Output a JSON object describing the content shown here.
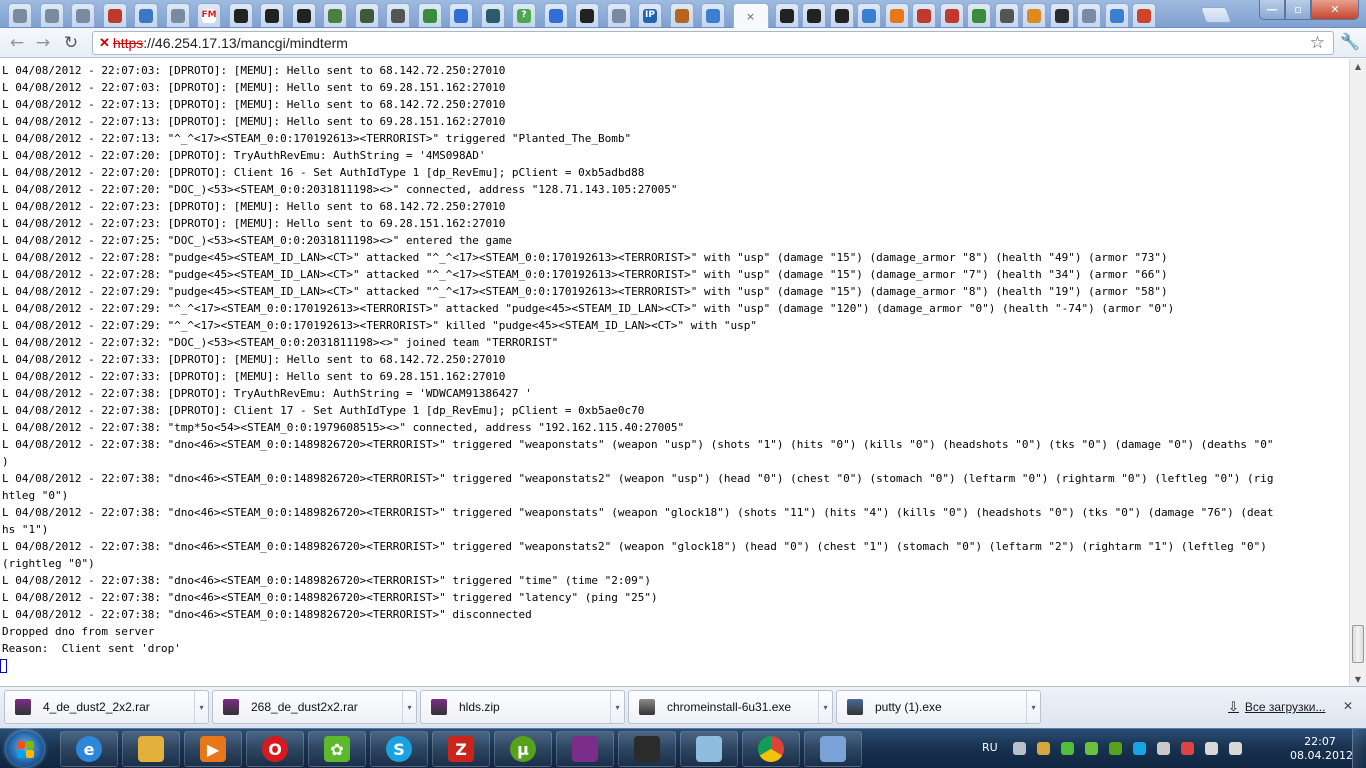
{
  "browser": {
    "tabs": [
      {
        "icon": "globe-icon",
        "color": "#7a8aa0",
        "glyph": ""
      },
      {
        "icon": "globe-icon",
        "color": "#7a8aa0",
        "glyph": ""
      },
      {
        "icon": "globe-icon",
        "color": "#7a8aa0",
        "glyph": ""
      },
      {
        "icon": "red-logo-icon",
        "color": "#c0392b",
        "glyph": ""
      },
      {
        "icon": "colored-squares-icon",
        "color": "#3b78c4",
        "glyph": ""
      },
      {
        "icon": "globe-icon",
        "color": "#7a8aa0",
        "glyph": ""
      },
      {
        "icon": "fm-icon",
        "color": "#ffffff",
        "glyph": "FM"
      },
      {
        "icon": "counter-strike-icon",
        "color": "#222222",
        "glyph": ""
      },
      {
        "icon": "counter-strike-icon",
        "color": "#222222",
        "glyph": ""
      },
      {
        "icon": "counter-strike-icon",
        "color": "#222222",
        "glyph": ""
      },
      {
        "icon": "target-icon",
        "color": "#4a7f3f",
        "glyph": ""
      },
      {
        "icon": "avatar-icon",
        "color": "#3d5a3a",
        "glyph": ""
      },
      {
        "icon": "counter-strike-icon",
        "color": "#555555",
        "glyph": ""
      },
      {
        "icon": "leaf-icon",
        "color": "#3b8b3b",
        "glyph": ""
      },
      {
        "icon": "google-icon",
        "color": "#2f6fd6",
        "glyph": ""
      },
      {
        "icon": "checkmark-icon",
        "color": "#2a5b6e",
        "glyph": ""
      },
      {
        "icon": "question-icon",
        "color": "#4fa84f",
        "glyph": "?"
      },
      {
        "icon": "google-icon",
        "color": "#2f6fd6",
        "glyph": ""
      },
      {
        "icon": "counter-strike-icon",
        "color": "#222222",
        "glyph": ""
      },
      {
        "icon": "globe-icon",
        "color": "#7a8aa0",
        "glyph": ""
      },
      {
        "icon": "ip-icon",
        "color": "#2364b0",
        "glyph": "IP"
      },
      {
        "icon": "fox-icon",
        "color": "#b5651d",
        "glyph": ""
      },
      {
        "icon": "blue-circle-icon",
        "color": "#3a7fd0",
        "glyph": ""
      }
    ],
    "active_tab_close": "×",
    "tabs_right": [
      {
        "icon": "counter-strike-icon",
        "color": "#222222"
      },
      {
        "icon": "counter-strike-icon",
        "color": "#222222"
      },
      {
        "icon": "counter-strike-icon",
        "color": "#222222"
      },
      {
        "icon": "globe-icon",
        "color": "#3a7fd0"
      },
      {
        "icon": "q-icon",
        "color": "#e8761b"
      },
      {
        "icon": "image-icon",
        "color": "#c0392b"
      },
      {
        "icon": "image-icon",
        "color": "#c0392b"
      },
      {
        "icon": "leaf-icon",
        "color": "#3b8b3b"
      },
      {
        "icon": "puzzle-icon",
        "color": "#555555"
      },
      {
        "icon": "globe-icon",
        "color": "#e08a1e"
      },
      {
        "icon": "s-icon",
        "color": "#2b2b2b"
      },
      {
        "icon": "globe-icon",
        "color": "#7a8aa0"
      },
      {
        "icon": "globe-icon",
        "color": "#3a7fd0"
      },
      {
        "icon": "java-icon",
        "color": "#d0432a"
      }
    ],
    "url_scheme": "https",
    "url_rest": "://46.254.17.13/mancgi/mindterm",
    "window_min": "—",
    "window_max": "▫",
    "window_close": "✕"
  },
  "terminal": {
    "lines": [
      "L 04/08/2012 - 22:07:03: [DPROTO]: [MEMU]: Hello sent to 68.142.72.250:27010",
      "L 04/08/2012 - 22:07:03: [DPROTO]: [MEMU]: Hello sent to 69.28.151.162:27010",
      "L 04/08/2012 - 22:07:13: [DPROTO]: [MEMU]: Hello sent to 68.142.72.250:27010",
      "L 04/08/2012 - 22:07:13: [DPROTO]: [MEMU]: Hello sent to 69.28.151.162:27010",
      "L 04/08/2012 - 22:07:13: \"^_^<17><STEAM_0:0:170192613><TERRORIST>\" triggered \"Planted_The_Bomb\"",
      "L 04/08/2012 - 22:07:20: [DPROTO]: TryAuthRevEmu: AuthString = '4MS098AD'",
      "L 04/08/2012 - 22:07:20: [DPROTO]: Client 16 - Set AuthIdType 1 [dp_RevEmu]; pClient = 0xb5adbd88",
      "L 04/08/2012 - 22:07:20: \"DOC_)<53><STEAM_0:0:2031811198><>\" connected, address \"128.71.143.105:27005\"",
      "L 04/08/2012 - 22:07:23: [DPROTO]: [MEMU]: Hello sent to 68.142.72.250:27010",
      "L 04/08/2012 - 22:07:23: [DPROTO]: [MEMU]: Hello sent to 69.28.151.162:27010",
      "L 04/08/2012 - 22:07:25: \"DOC_)<53><STEAM_0:0:2031811198><>\" entered the game",
      "L 04/08/2012 - 22:07:28: \"pudge<45><STEAM_ID_LAN><CT>\" attacked \"^_^<17><STEAM_0:0:170192613><TERRORIST>\" with \"usp\" (damage \"15\") (damage_armor \"8\") (health \"49\") (armor \"73\")",
      "L 04/08/2012 - 22:07:28: \"pudge<45><STEAM_ID_LAN><CT>\" attacked \"^_^<17><STEAM_0:0:170192613><TERRORIST>\" with \"usp\" (damage \"15\") (damage_armor \"7\") (health \"34\") (armor \"66\")",
      "L 04/08/2012 - 22:07:29: \"pudge<45><STEAM_ID_LAN><CT>\" attacked \"^_^<17><STEAM_0:0:170192613><TERRORIST>\" with \"usp\" (damage \"15\") (damage_armor \"8\") (health \"19\") (armor \"58\")",
      "L 04/08/2012 - 22:07:29: \"^_^<17><STEAM_0:0:170192613><TERRORIST>\" attacked \"pudge<45><STEAM_ID_LAN><CT>\" with \"usp\" (damage \"120\") (damage_armor \"0\") (health \"-74\") (armor \"0\")",
      "L 04/08/2012 - 22:07:29: \"^_^<17><STEAM_0:0:170192613><TERRORIST>\" killed \"pudge<45><STEAM_ID_LAN><CT>\" with \"usp\"",
      "L 04/08/2012 - 22:07:32: \"DOC_)<53><STEAM_0:0:2031811198><>\" joined team \"TERRORIST\"",
      "L 04/08/2012 - 22:07:33: [DPROTO]: [MEMU]: Hello sent to 68.142.72.250:27010",
      "L 04/08/2012 - 22:07:33: [DPROTO]: [MEMU]: Hello sent to 69.28.151.162:27010",
      "L 04/08/2012 - 22:07:38: [DPROTO]: TryAuthRevEmu: AuthString = 'WDWCAM91386427 '",
      "L 04/08/2012 - 22:07:38: [DPROTO]: Client 17 - Set AuthIdType 1 [dp_RevEmu]; pClient = 0xb5ae0c70",
      "L 04/08/2012 - 22:07:38: \"tmp*5o<54><STEAM_0:0:1979608515><>\" connected, address \"192.162.115.40:27005\"",
      "L 04/08/2012 - 22:07:38: \"dno<46><STEAM_0:0:1489826720><TERRORIST>\" triggered \"weaponstats\" (weapon \"usp\") (shots \"1\") (hits \"0\") (kills \"0\") (headshots \"0\") (tks \"0\") (damage \"0\") (deaths \"0\"",
      ")",
      "L 04/08/2012 - 22:07:38: \"dno<46><STEAM_0:0:1489826720><TERRORIST>\" triggered \"weaponstats2\" (weapon \"usp\") (head \"0\") (chest \"0\") (stomach \"0\") (leftarm \"0\") (rightarm \"0\") (leftleg \"0\") (rig",
      "htleg \"0\")",
      "L 04/08/2012 - 22:07:38: \"dno<46><STEAM_0:0:1489826720><TERRORIST>\" triggered \"weaponstats\" (weapon \"glock18\") (shots \"11\") (hits \"4\") (kills \"0\") (headshots \"0\") (tks \"0\") (damage \"76\") (deat",
      "hs \"1\")",
      "L 04/08/2012 - 22:07:38: \"dno<46><STEAM_0:0:1489826720><TERRORIST>\" triggered \"weaponstats2\" (weapon \"glock18\") (head \"0\") (chest \"1\") (stomach \"0\") (leftarm \"2\") (rightarm \"1\") (leftleg \"0\")",
      "(rightleg \"0\")",
      "L 04/08/2012 - 22:07:38: \"dno<46><STEAM_0:0:1489826720><TERRORIST>\" triggered \"time\" (time \"2:09\")",
      "L 04/08/2012 - 22:07:38: \"dno<46><STEAM_0:0:1489826720><TERRORIST>\" triggered \"latency\" (ping \"25\")",
      "L 04/08/2012 - 22:07:38: \"dno<46><STEAM_0:0:1489826720><TERRORIST>\" disconnected",
      "Dropped dno from server",
      "Reason:  Client sent 'drop'"
    ]
  },
  "downloads": {
    "items": [
      {
        "name": "4_de_dust2_2x2.rar",
        "icon": "winrar-icon",
        "color": "#7b2d8b"
      },
      {
        "name": "268_de_dust2x2.rar",
        "icon": "winrar-icon",
        "color": "#7b2d8b"
      },
      {
        "name": "hlds.zip",
        "icon": "winrar-icon",
        "color": "#7b2d8b"
      },
      {
        "name": "chromeinstall-6u31.exe",
        "icon": "installer-icon",
        "color": "#8a8a8a"
      },
      {
        "name": "putty (1).exe",
        "icon": "putty-icon",
        "color": "#4a6a9a"
      }
    ],
    "all_label": "Все загрузки...",
    "close": "✕"
  },
  "taskbar": {
    "apps": [
      {
        "name": "internet-explorer-icon",
        "color": "#2d86d8",
        "glyph": "e"
      },
      {
        "name": "explorer-icon",
        "color": "#e3b13b",
        "glyph": ""
      },
      {
        "name": "media-player-icon",
        "color": "#e8761b",
        "glyph": "▶"
      },
      {
        "name": "opera-icon",
        "color": "#d8191f",
        "glyph": "O"
      },
      {
        "name": "icq-icon",
        "color": "#5cb82c",
        "glyph": "✿"
      },
      {
        "name": "skype-icon",
        "color": "#1aa3e2",
        "glyph": "S"
      },
      {
        "name": "filezilla-icon",
        "color": "#c9251b",
        "glyph": "Z"
      },
      {
        "name": "utorrent-icon",
        "color": "#56a31b",
        "glyph": "µ"
      },
      {
        "name": "winrar-icon",
        "color": "#7b2d8b",
        "glyph": ""
      },
      {
        "name": "counter-strike-icon",
        "color": "#2b2b2b",
        "glyph": ""
      },
      {
        "name": "notes-icon",
        "color": "#8fbde0",
        "glyph": ""
      },
      {
        "name": "chrome-icon",
        "color": "#dd4b39",
        "glyph": ""
      },
      {
        "name": "paint-icon",
        "color": "#7aa4d8",
        "glyph": ""
      }
    ],
    "lang": "RU",
    "time": "22:07",
    "date": "08.04.2012",
    "tray": [
      {
        "name": "printer-tray-icon",
        "color": "#b8c0cc"
      },
      {
        "name": "battery-tray-icon",
        "color": "#d8a63a"
      },
      {
        "name": "security-tray-icon",
        "color": "#4fbf3a"
      },
      {
        "name": "icq-tray-icon",
        "color": "#6bc23a"
      },
      {
        "name": "utorrent-tray-icon",
        "color": "#56a31b"
      },
      {
        "name": "skype-tray-icon",
        "color": "#1aa3e2"
      },
      {
        "name": "steam-tray-icon",
        "color": "#c9c9c9"
      },
      {
        "name": "network-tray-icon",
        "color": "#d44"
      },
      {
        "name": "flag-tray-icon",
        "color": "#d8d8d8"
      },
      {
        "name": "volume-tray-icon",
        "color": "#d8d8d8"
      }
    ]
  }
}
